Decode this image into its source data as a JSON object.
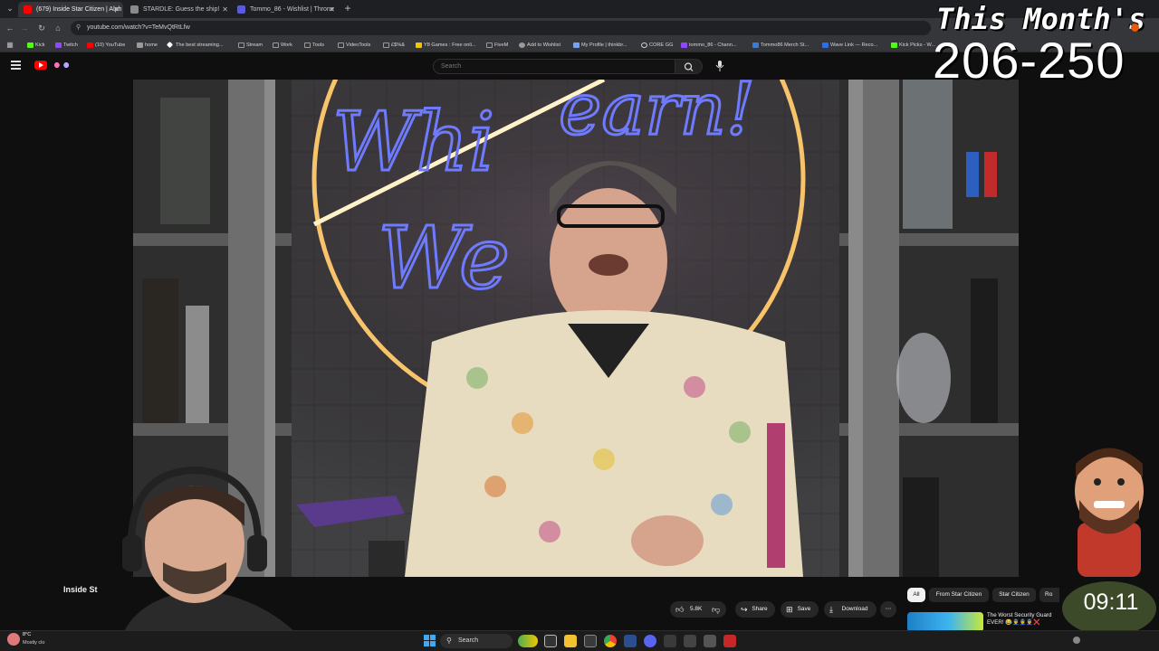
{
  "tabs": [
    {
      "title": "(679) Inside Star Citizen | Alph",
      "color": "#ff0000",
      "active": true
    },
    {
      "title": "STARDLE: Guess the ship!",
      "color": "#8a8a8a",
      "active": false
    },
    {
      "title": "Tommo_86 - Wishlist | Throne",
      "color": "#5b5bd6",
      "active": false
    }
  ],
  "address": {
    "url": "youtube.com/watch?v=TeMvQtRtLfw"
  },
  "bookmarks": [
    {
      "label": "Kick",
      "color": "#53fc18"
    },
    {
      "label": "Twitch",
      "color": "#9146ff"
    },
    {
      "label": "(10) YouTube",
      "color": "#ff0000"
    },
    {
      "label": "home",
      "color": "#9a9a9a"
    },
    {
      "label": "The best streaming...",
      "color": "#ffffff"
    },
    {
      "label": "Stream",
      "color": "#9a9a9a"
    },
    {
      "label": "Work",
      "color": "#9a9a9a"
    },
    {
      "label": "Tools",
      "color": "#9a9a9a"
    },
    {
      "label": "VideoTools",
      "color": "#9a9a9a"
    },
    {
      "label": "£$%&",
      "color": "#9a9a9a"
    },
    {
      "label": "Y8 Games : Free onli...",
      "color": "#f5c400"
    },
    {
      "label": "FiveM",
      "color": "#9a9a9a"
    },
    {
      "label": "Add to Wishlist",
      "color": "#9a9a9a"
    },
    {
      "label": "My Profile | thinkbr...",
      "color": "#6fa3ff"
    },
    {
      "label": "CORE GG",
      "color": "#cfcfcf"
    },
    {
      "label": "tommo_86 - Chann...",
      "color": "#9146ff"
    },
    {
      "label": "Tommo86 Merch St...",
      "color": "#3a7bd5"
    },
    {
      "label": "Wave Link — Reco...",
      "color": "#2b6fe0"
    },
    {
      "label": "Kick Picks - W...",
      "color": "#53fc18"
    }
  ],
  "youtube": {
    "search_placeholder": "Search",
    "voice_icon": "mic-icon"
  },
  "overlay": {
    "title": "This Month's",
    "count": "206-250",
    "timer": "09:11"
  },
  "below_video": {
    "title_partial": "Inside St",
    "likes": "5.8K",
    "share_label": "Share",
    "save_label": "Save",
    "download_label": "Download",
    "chips": [
      "All",
      "From Star Citizen",
      "Star Citizen",
      "Ro"
    ],
    "related_title": "The Worst Security Guard EVER! 😂👮‍♂️👮‍♂️👮‍♂️❌"
  },
  "taskbar": {
    "weather_temp": "8°C",
    "weather_desc": "Mostly clo",
    "search_label": "Search"
  }
}
